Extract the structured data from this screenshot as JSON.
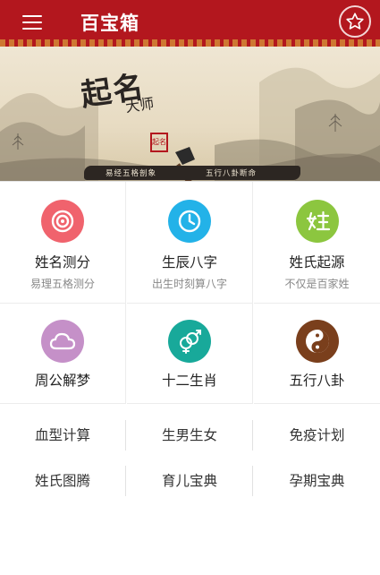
{
  "header": {
    "title": "百宝箱",
    "menu_icon": "menu-icon",
    "favorite_icon": "star-icon",
    "background": "#b3171e"
  },
  "banner": {
    "title": "起名",
    "subtitle": "大师",
    "seal_text": "起名",
    "slogan_left": "易经五格剖象",
    "slogan_right": "五行八卦断命"
  },
  "tools": [
    {
      "name": "姓名测分",
      "desc": "易理五格测分",
      "icon": "target-icon",
      "color": "#f0636d"
    },
    {
      "name": "生辰八字",
      "desc": "出生时刻算八字",
      "icon": "clock-icon",
      "color": "#23b2e8"
    },
    {
      "name": "姓氏起源",
      "desc": "不仅是百家姓",
      "icon": "surname-icon",
      "color": "#8cc63f"
    },
    {
      "name": "周公解梦",
      "desc": "",
      "icon": "cloud-icon",
      "color": "#c590c8"
    },
    {
      "name": "十二生肖",
      "desc": "",
      "icon": "gender-icon",
      "color": "#18a99a"
    },
    {
      "name": "五行八卦",
      "desc": "",
      "icon": "yin-yang-icon",
      "color": "#7a3f1c"
    }
  ],
  "links": [
    "血型计算",
    "生男生女",
    "免疫计划",
    "姓氏图腾",
    "育儿宝典",
    "孕期宝典"
  ]
}
